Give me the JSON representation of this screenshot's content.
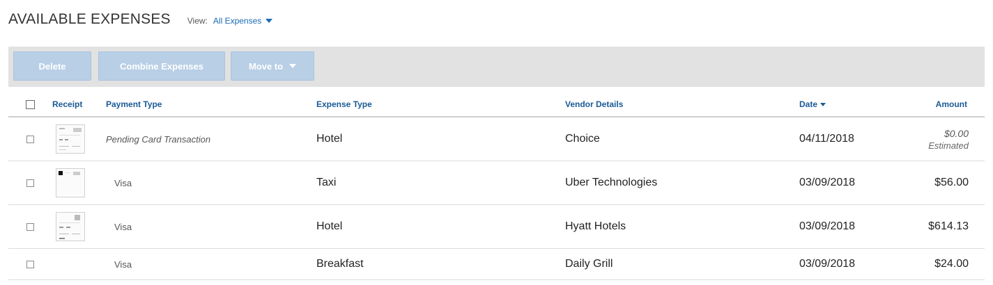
{
  "header": {
    "title": "AVAILABLE EXPENSES",
    "view_label": "View:",
    "view_value": "All Expenses"
  },
  "toolbar": {
    "delete_label": "Delete",
    "combine_label": "Combine Expenses",
    "move_label": "Move to"
  },
  "columns": {
    "receipt": "Receipt",
    "payment_type": "Payment Type",
    "expense_type": "Expense Type",
    "vendor": "Vendor Details",
    "date": "Date",
    "amount": "Amount"
  },
  "rows": [
    {
      "payment_type": "Pending Card Transaction",
      "expense_type": "Hotel",
      "vendor": "Choice",
      "date": "04/11/2018",
      "amount": "$0.00",
      "amount_note": "Estimated",
      "has_receipt": true
    },
    {
      "payment_type": "Visa",
      "expense_type": "Taxi",
      "vendor": "Uber Technologies",
      "date": "03/09/2018",
      "amount": "$56.00",
      "has_receipt": true
    },
    {
      "payment_type": "Visa",
      "expense_type": "Hotel",
      "vendor": "Hyatt Hotels",
      "date": "03/09/2018",
      "amount": "$614.13",
      "has_receipt": true
    },
    {
      "payment_type": "Visa",
      "expense_type": "Breakfast",
      "vendor": "Daily Grill",
      "date": "03/09/2018",
      "amount": "$24.00",
      "has_receipt": false
    }
  ],
  "colors": {
    "accent": "#1a6bb5",
    "header_text": "#1a5a96",
    "toolbar_bg": "#e2e2e2",
    "button_disabled": "#b8cfe6"
  }
}
